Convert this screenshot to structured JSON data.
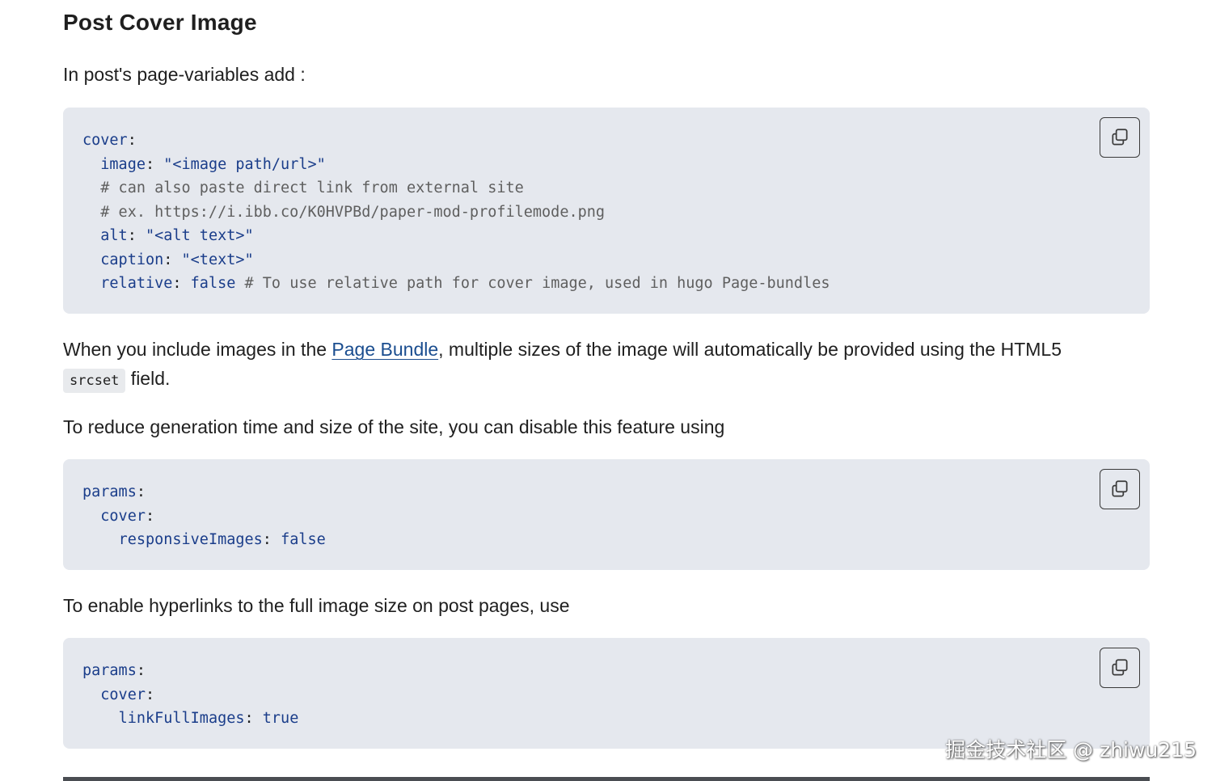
{
  "heading": "Post Cover Image",
  "intro": "In post's page-variables add :",
  "code_blocks": [
    {
      "lines": [
        {
          "indent": "",
          "key": "cover",
          "sep": ":",
          "value": "",
          "comment": ""
        },
        {
          "indent": "  ",
          "key": "image",
          "sep": ": ",
          "value": "\"<image path/url>\"",
          "comment": ""
        },
        {
          "indent": "  ",
          "key": "",
          "sep": "",
          "value": "",
          "comment": "# can also paste direct link from external site"
        },
        {
          "indent": "  ",
          "key": "",
          "sep": "",
          "value": "",
          "comment": "# ex. https://i.ibb.co/K0HVPBd/paper-mod-profilemode.png"
        },
        {
          "indent": "  ",
          "key": "alt",
          "sep": ": ",
          "value": "\"<alt text>\"",
          "comment": ""
        },
        {
          "indent": "  ",
          "key": "caption",
          "sep": ": ",
          "value": "\"<text>\"",
          "comment": ""
        },
        {
          "indent": "  ",
          "key": "relative",
          "sep": ": ",
          "value": "false",
          "comment": " # To use relative path for cover image, used in hugo Page-bundles"
        }
      ]
    },
    {
      "lines": [
        {
          "indent": "",
          "key": "params",
          "sep": ":",
          "value": "",
          "comment": ""
        },
        {
          "indent": "  ",
          "key": "cover",
          "sep": ":",
          "value": "",
          "comment": ""
        },
        {
          "indent": "    ",
          "key": "responsiveImages",
          "sep": ": ",
          "value": "false",
          "comment": ""
        }
      ]
    },
    {
      "lines": [
        {
          "indent": "",
          "key": "params",
          "sep": ":",
          "value": "",
          "comment": ""
        },
        {
          "indent": "  ",
          "key": "cover",
          "sep": ":",
          "value": "",
          "comment": ""
        },
        {
          "indent": "    ",
          "key": "linkFullImages",
          "sep": ": ",
          "value": "true",
          "comment": ""
        }
      ]
    }
  ],
  "para_bundle": {
    "before": "When you include images in the ",
    "link": "Page Bundle",
    "after": ", multiple sizes of the image will automatically be provided using the HTML5",
    "code": "srcset",
    "tail": " field."
  },
  "para_reduce": "To reduce generation time and size of the site, you can disable this feature using",
  "para_hyperlinks": "To enable hyperlinks to the full image size on post pages, use",
  "copy_icon": "copy-icon",
  "watermark": "掘金技术社区 @ zhiwu215"
}
